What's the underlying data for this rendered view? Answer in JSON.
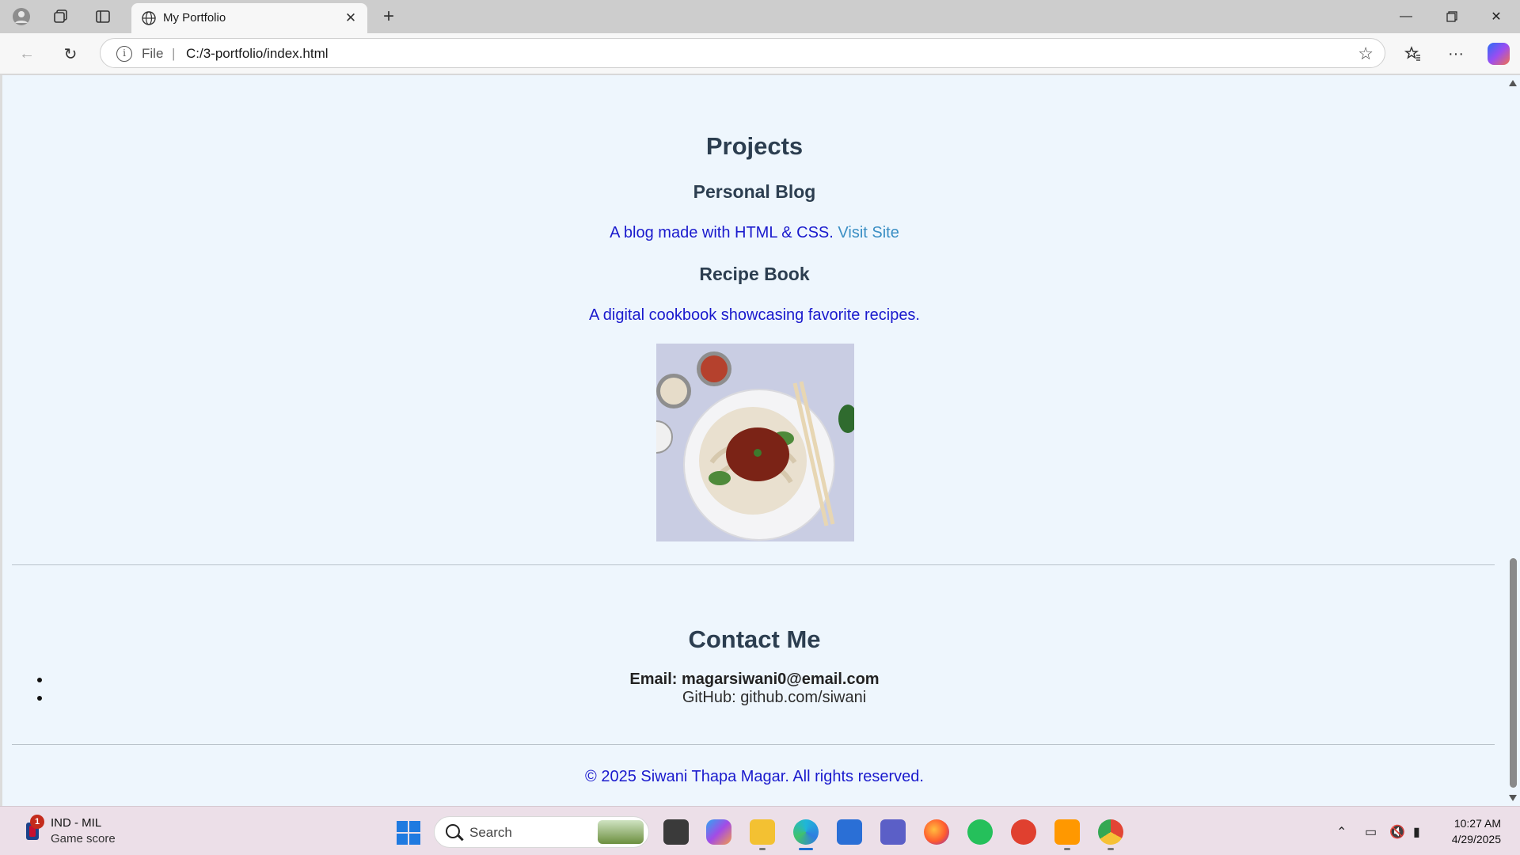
{
  "browser": {
    "tab_title": "My Portfolio",
    "address_scheme": "File",
    "address_url": "C:/3-portfolio/index.html"
  },
  "page": {
    "projects": {
      "heading": "Projects",
      "items": [
        {
          "title": "Personal Blog",
          "description": "A blog made with HTML & CSS.",
          "link_text": "Visit Site"
        },
        {
          "title": "Recipe Book",
          "description": "A digital cookbook showcasing favorite recipes."
        }
      ],
      "image_subject": "plate of noodles with meat sauce"
    },
    "contact": {
      "heading": "Contact Me",
      "email": "Email: magarsiwani0@email.com",
      "github": "GitHub: github.com/siwani"
    },
    "footer": "© 2025 Siwani Thapa Magar. All rights reserved."
  },
  "taskbar": {
    "widget_badge": "1",
    "widget_title": "IND - MIL",
    "widget_subtitle": "Game score",
    "search_placeholder": "Search",
    "time": "10:27 AM",
    "date": "4/29/2025"
  }
}
